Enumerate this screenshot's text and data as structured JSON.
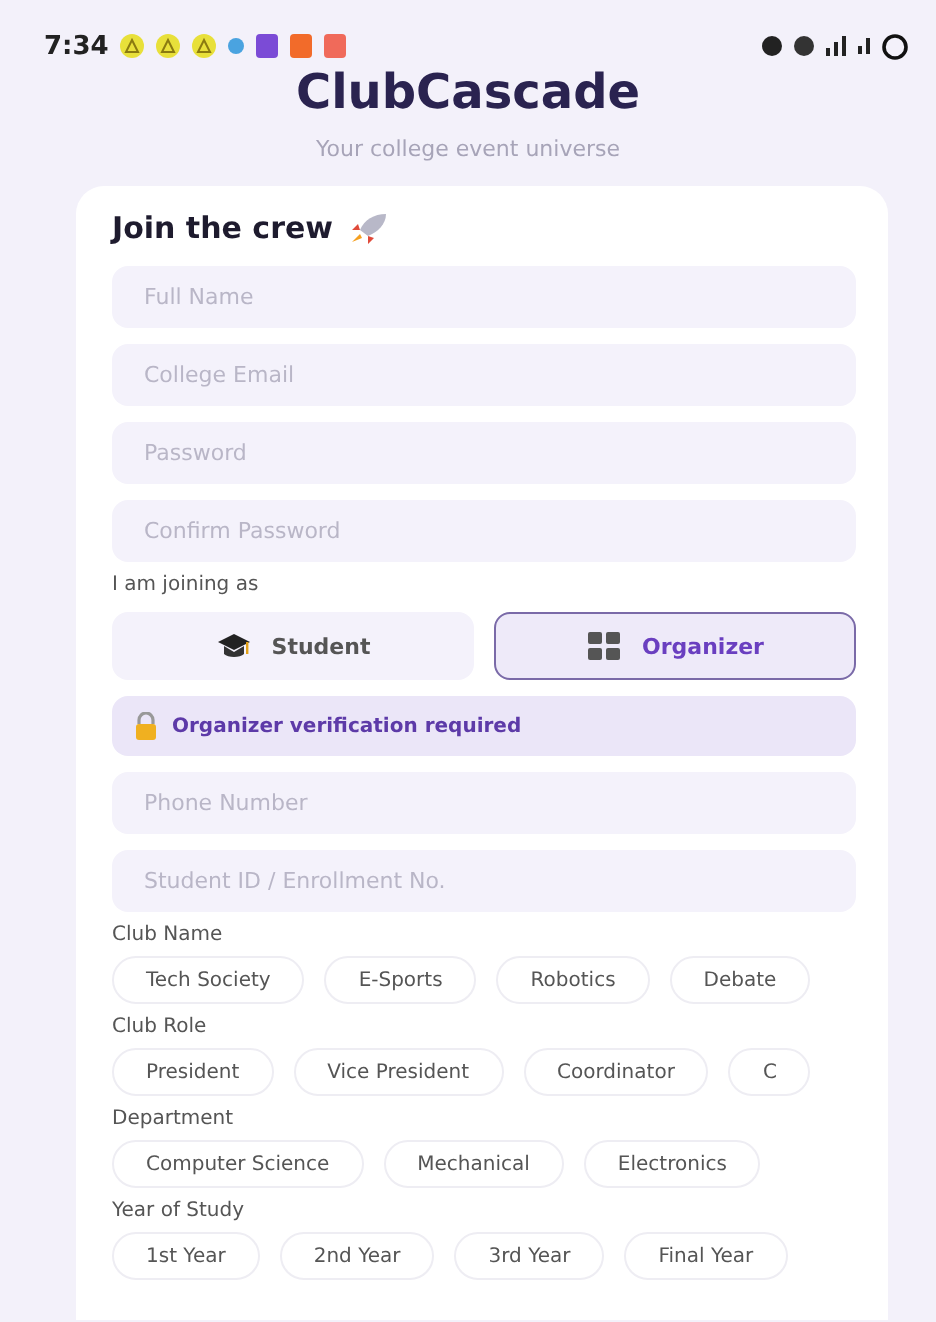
{
  "status_bar": {
    "time": "7:34"
  },
  "app": {
    "title": "ClubCascade",
    "subtitle": "Your college event universe"
  },
  "form": {
    "heading": "Join the crew",
    "fields": [
      {
        "placeholder": "Full Name"
      },
      {
        "placeholder": "College Email"
      },
      {
        "placeholder": "Password"
      },
      {
        "placeholder": "Confirm Password"
      }
    ],
    "role_label": "I am joining as",
    "roles": [
      {
        "label": "Student",
        "kind": "cap",
        "selected": false
      },
      {
        "label": "Organizer",
        "kind": "grid",
        "selected": true
      }
    ],
    "notice": "Organizer verification required",
    "organizer_fields": [
      {
        "placeholder": "Phone Number"
      },
      {
        "placeholder": "Student ID / Enrollment No."
      }
    ],
    "groups": [
      {
        "label": "Club Name",
        "options": [
          {
            "label": "Tech Society",
            "selected": false
          },
          {
            "label": "E-Sports",
            "selected": false
          },
          {
            "label": "Robotics",
            "selected": false
          },
          {
            "label": "Debate",
            "selected": false
          }
        ]
      },
      {
        "label": "Club Role",
        "options": [
          {
            "label": "President",
            "selected": false
          },
          {
            "label": "Vice President",
            "selected": false
          },
          {
            "label": "Coordinator",
            "selected": false
          },
          {
            "label": "C",
            "selected": false
          }
        ]
      },
      {
        "label": "Department",
        "options": [
          {
            "label": "Computer Science",
            "selected": false
          },
          {
            "label": "Mechanical",
            "selected": false
          },
          {
            "label": "Electronics",
            "selected": false
          }
        ]
      },
      {
        "label": "Year of Study",
        "options": [
          {
            "label": "1st Year",
            "selected": false
          },
          {
            "label": "2nd Year",
            "selected": false
          },
          {
            "label": "3rd Year",
            "selected": false
          },
          {
            "label": "Final Year",
            "selected": false
          }
        ]
      }
    ]
  }
}
